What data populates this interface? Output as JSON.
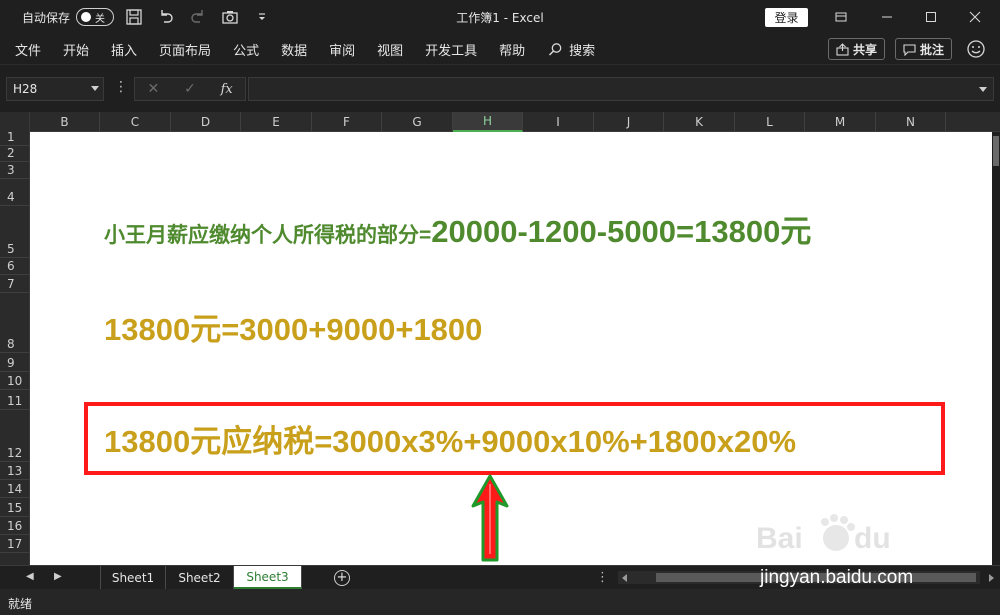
{
  "titlebar": {
    "autosave_label": "自动保存",
    "autosave_state": "关",
    "window_title": "工作簿1 - Excel",
    "login_label": "登录"
  },
  "menu": {
    "items": [
      "文件",
      "开始",
      "插入",
      "页面布局",
      "公式",
      "数据",
      "审阅",
      "视图",
      "开发工具",
      "帮助"
    ],
    "search_label": "搜索",
    "share_label": "共享",
    "comment_label": "批注"
  },
  "formula_bar": {
    "name_box": "H28",
    "fx_label": "fx",
    "formula_value": ""
  },
  "grid": {
    "columns": [
      "B",
      "C",
      "D",
      "E",
      "F",
      "G",
      "H",
      "I",
      "J",
      "K",
      "L",
      "M",
      "N"
    ],
    "active_column": "H",
    "rows": [
      "1",
      "2",
      "3",
      "4",
      "5",
      "6",
      "7",
      "8",
      "9",
      "10",
      "11",
      "12",
      "13",
      "14",
      "15",
      "16",
      "17"
    ]
  },
  "cells": {
    "line1_prefix": "小王月薪应缴纳个人所得税的部分=",
    "line1_formula": "20000-1200-5000=13800元",
    "line2": "13800元=3000+9000+1800",
    "line3": "13800元应纳税=3000x3%+9000x10%+1800x20%"
  },
  "sheets": {
    "tabs": [
      "Sheet1",
      "Sheet2",
      "Sheet3"
    ],
    "active": "Sheet3"
  },
  "status": {
    "text": "就绪"
  },
  "watermark": {
    "url": "jingyan.baidu.com"
  },
  "colors": {
    "line1": "#4f8a2f",
    "highlight_text": "#c9a01c",
    "redbox": "#ff1a1a",
    "arrow_fill": "#ff1a1a",
    "arrow_outline": "#1f9a2a",
    "active_tab": "#2e7d32"
  }
}
